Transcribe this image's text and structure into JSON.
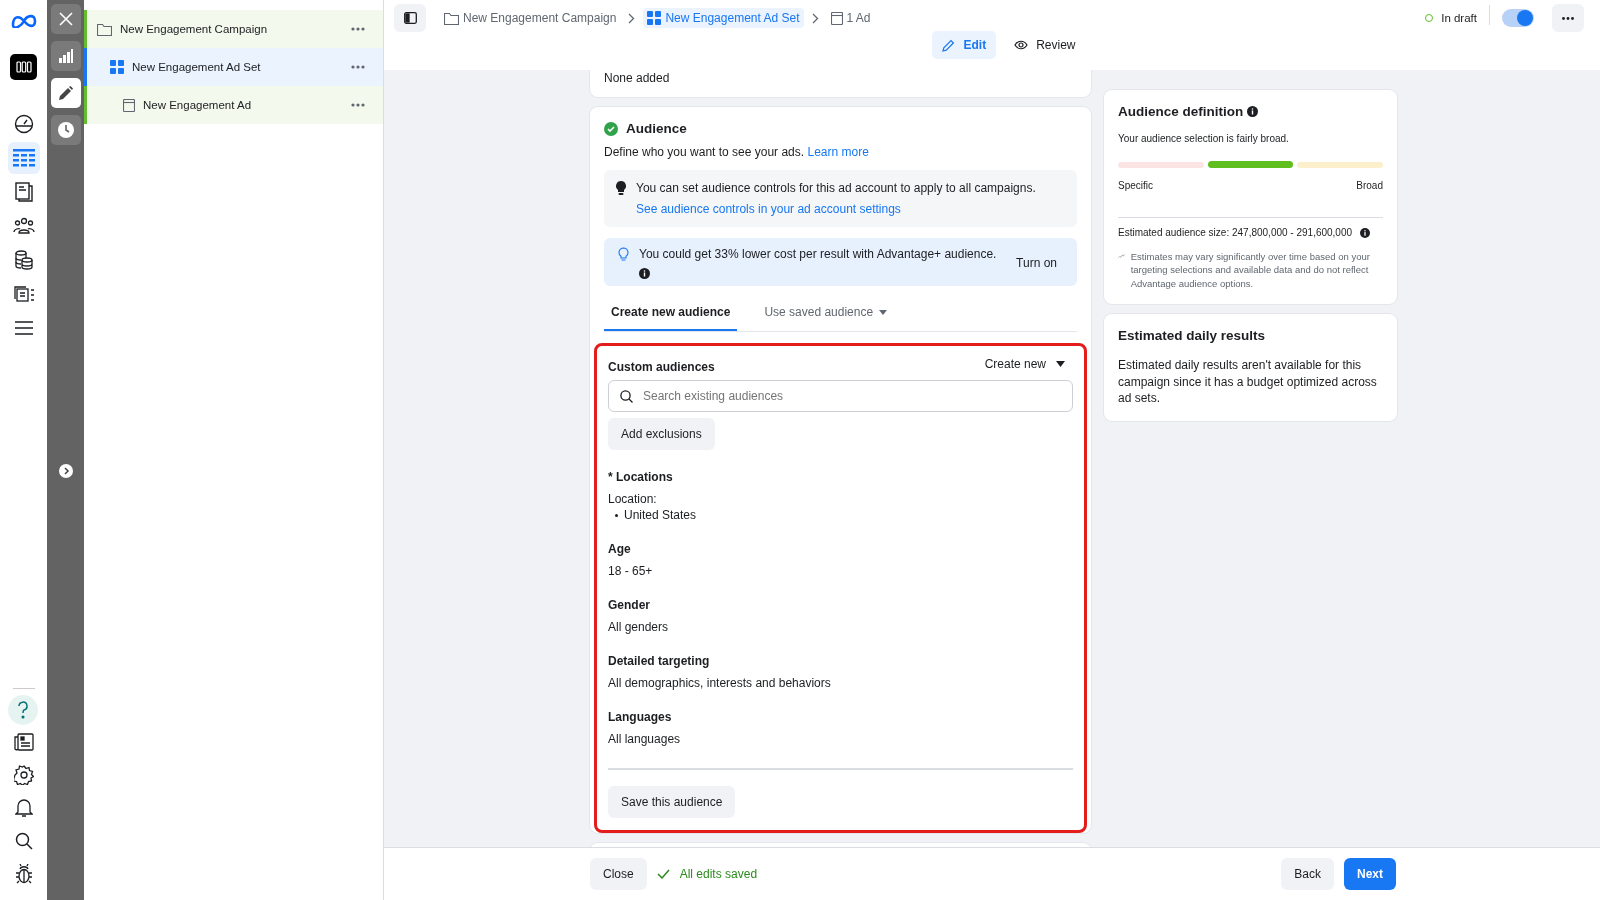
{
  "rail": [
    {
      "kind": "gauge",
      "selected": false
    },
    {
      "kind": "table",
      "selected": true
    },
    {
      "kind": "pages",
      "selected": false
    },
    {
      "kind": "people",
      "selected": false
    },
    {
      "kind": "stack",
      "selected": false
    },
    {
      "kind": "catalog",
      "selected": false
    },
    {
      "kind": "menu",
      "selected": false
    }
  ],
  "rail_bottom": [
    {
      "kind": "help"
    },
    {
      "kind": "news"
    },
    {
      "kind": "gear"
    },
    {
      "kind": "bell"
    },
    {
      "kind": "search"
    },
    {
      "kind": "bug"
    }
  ],
  "tools": [
    {
      "kind": "close",
      "selected": false
    },
    {
      "kind": "chart",
      "selected": false
    },
    {
      "kind": "pencil",
      "selected": true
    },
    {
      "kind": "clock",
      "selected": false
    }
  ],
  "tree": [
    {
      "kind": "campaign",
      "label": "New Engagement Campaign",
      "selected": false,
      "children": [
        {
          "kind": "adset",
          "label": "New Engagement Ad Set",
          "selected": true,
          "children": [
            {
              "kind": "ad",
              "label": "New Engagement Ad",
              "selected": false
            }
          ]
        }
      ]
    }
  ],
  "breadcrumb": [
    {
      "kind": "campaign",
      "label": "New Engagement Campaign",
      "selected": false
    },
    {
      "kind": "adset",
      "label": "New Engagement Ad Set",
      "selected": true
    },
    {
      "kind": "ad",
      "label": "1 Ad",
      "selected": false
    }
  ],
  "status": {
    "label": "In draft",
    "on": true
  },
  "modes": [
    {
      "kind": "edit",
      "label": "Edit",
      "selected": true
    },
    {
      "kind": "review",
      "label": "Review",
      "selected": false
    }
  ],
  "prev_card": {
    "text": "None added"
  },
  "audience": {
    "title": "Audience",
    "complete": true,
    "description": "Define who you want to see your ads.",
    "link": "Learn more",
    "controls_notice": {
      "text": "You can set audience controls for this ad account to apply to all campaigns.",
      "link": "See audience controls in your ad account settings"
    },
    "advantage_notice": {
      "text": "You could get 33% lower cost per result with Advantage+ audience.",
      "action": "Turn on"
    },
    "tabs": [
      {
        "label": "Create new audience",
        "selected": true,
        "dropdown": false
      },
      {
        "label": "Use saved audience",
        "selected": false,
        "dropdown": true
      }
    ],
    "custom": {
      "label": "Custom audiences",
      "create": "Create new",
      "placeholder": "Search existing audiences",
      "exclusions": "Add exclusions"
    },
    "sections": [
      {
        "label": "* Locations",
        "sublabel": "Location:",
        "items": [
          "United States"
        ]
      },
      {
        "label": "Age",
        "value": "18 - 65+"
      },
      {
        "label": "Gender",
        "value": "All genders"
      },
      {
        "label": "Detailed targeting",
        "value": "All demographics, interests and behaviors"
      },
      {
        "label": "Languages",
        "value": "All languages"
      }
    ],
    "save": "Save this audience"
  },
  "definition": {
    "title": "Audience definition",
    "summary": "Your audience selection is fairly broad.",
    "segments": [
      {
        "selected": false,
        "color": "#fce4e4"
      },
      {
        "selected": true,
        "color": "#5fbf1f"
      },
      {
        "selected": false,
        "color": "#fcefcc"
      }
    ],
    "low": "Specific",
    "high": "Broad",
    "size": "Estimated audience size: 247,800,000 - 291,600,000",
    "note": "Estimates may vary significantly over time based on your targeting selections and available data and do not reflect Advantage audience options."
  },
  "daily": {
    "title": "Estimated daily results",
    "text": "Estimated daily results aren't available for this campaign since it has a budget optimized across ad sets."
  },
  "footer": {
    "close": "Close",
    "saved": "All edits saved",
    "back": "Back",
    "next": "Next"
  }
}
